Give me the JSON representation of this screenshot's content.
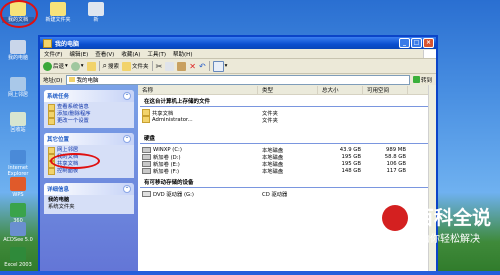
{
  "desktop_icons": [
    {
      "label": "我的文档"
    },
    {
      "label": "新建文件夹"
    },
    {
      "label": "新"
    },
    {
      "label": "我的电脑"
    },
    {
      "label": "网上邻居"
    },
    {
      "label": "回收站"
    },
    {
      "label": "Internet Explorer"
    },
    {
      "label": "WPS"
    },
    {
      "label": "360"
    },
    {
      "label": "ACDSee 5.0"
    },
    {
      "label": "Excel 2003"
    }
  ],
  "window": {
    "title": "我的电脑"
  },
  "menu": [
    "文件(F)",
    "编辑(E)",
    "查看(V)",
    "收藏(A)",
    "工具(T)",
    "帮助(H)"
  ],
  "toolbar": {
    "back": "后退",
    "search": "搜索",
    "folders": "文件夹"
  },
  "address": {
    "label": "地址(D)",
    "value": "我的电脑",
    "go": "转到"
  },
  "sidebar": {
    "system_tasks": {
      "title": "系统任务",
      "items": [
        "查看系统信息",
        "添加/删除程序",
        "更改一个设置"
      ]
    },
    "other_places": {
      "title": "其它位置",
      "items": [
        "网上邻居",
        "我的文档",
        "共享文档",
        "控制面板"
      ]
    },
    "details": {
      "title": "详细信息",
      "name": "我的电脑",
      "sub": "系统文件夹"
    }
  },
  "columns": [
    "名称",
    "类型",
    "总大小",
    "可用空间"
  ],
  "groups": {
    "stored": {
      "title": "在这台计算机上存储的文件",
      "rows": [
        {
          "name": "共享文档",
          "type": "文件夹"
        },
        {
          "name": "Administrator...",
          "type": "文件夹"
        }
      ]
    },
    "drives": {
      "title": "硬盘",
      "rows": [
        {
          "name": "WINXP (C:)",
          "type": "本地磁盘",
          "total": "43.9 GB",
          "free": "989 MB"
        },
        {
          "name": "新加卷 (D:)",
          "type": "本地磁盘",
          "total": "195 GB",
          "free": "58.8 GB"
        },
        {
          "name": "新加卷 (E:)",
          "type": "本地磁盘",
          "total": "195 GB",
          "free": "106 GB"
        },
        {
          "name": "新加卷 (F:)",
          "type": "本地磁盘",
          "total": "148 GB",
          "free": "117 GB"
        }
      ]
    },
    "removable": {
      "title": "有可移动存储的设备",
      "rows": [
        {
          "name": "DVD 驱动器 (G:)",
          "type": "CD 驱动器"
        }
      ]
    }
  },
  "watermark": {
    "title": "百科全说",
    "sub": "助你轻松解决"
  }
}
